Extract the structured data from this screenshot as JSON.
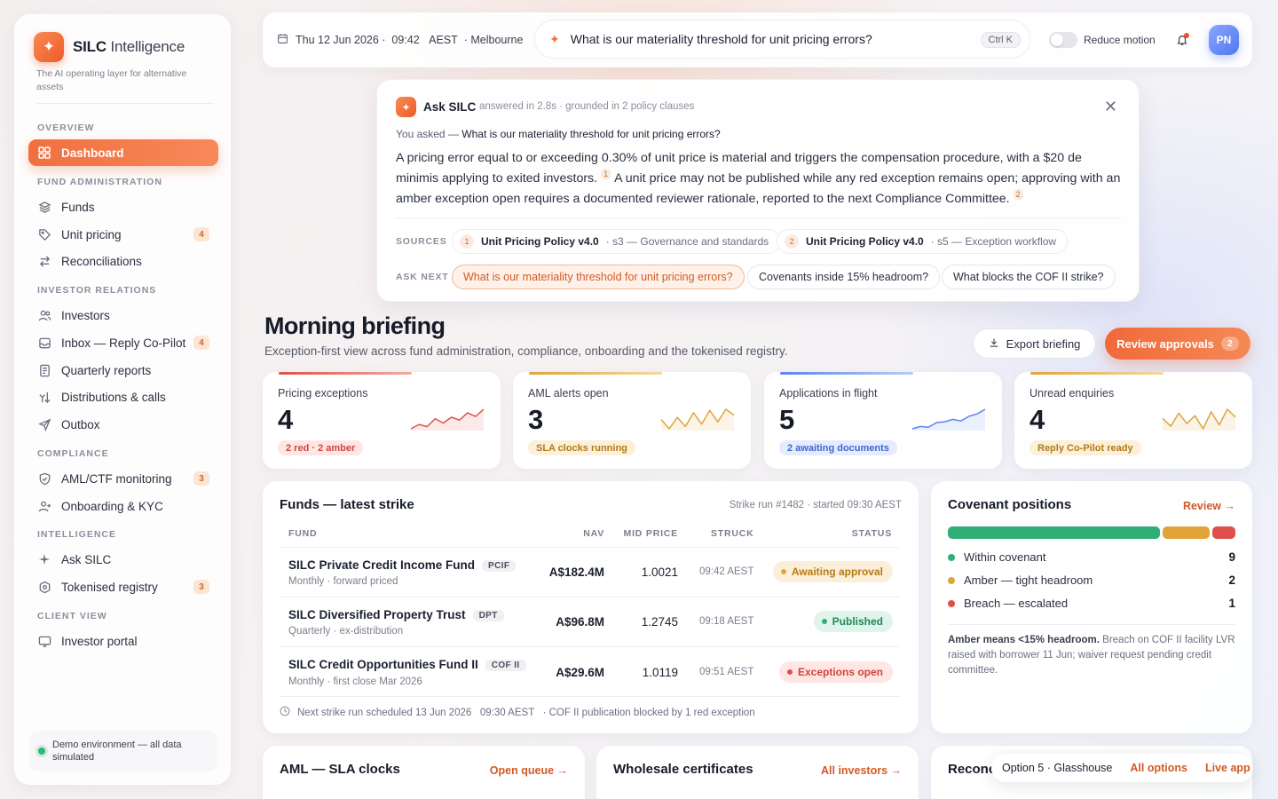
{
  "brand": {
    "name_bold": "SILC",
    "name_rest": "Intelligence",
    "tagline": "The AI operating layer for alternative assets"
  },
  "sidebar": {
    "sections": [
      "OVERVIEW",
      "FUND ADMINISTRATION",
      "INVESTOR RELATIONS",
      "COMPLIANCE",
      "INTELLIGENCE",
      "CLIENT VIEW"
    ],
    "items": [
      {
        "label": "Dashboard",
        "icon": "grid-icon"
      },
      {
        "label": "Funds",
        "icon": "layers-icon"
      },
      {
        "label": "Unit pricing",
        "icon": "tag-icon",
        "badge": "4"
      },
      {
        "label": "Reconciliations",
        "icon": "arrows-swap-icon"
      },
      {
        "label": "Investors",
        "icon": "users-icon"
      },
      {
        "label": "Inbox — Reply Co-Pilot",
        "icon": "inbox-icon",
        "badge": "4"
      },
      {
        "label": "Quarterly reports",
        "icon": "document-icon"
      },
      {
        "label": "Distributions & calls",
        "icon": "split-arrows-icon"
      },
      {
        "label": "Outbox",
        "icon": "send-icon"
      },
      {
        "label": "AML/CTF monitoring",
        "icon": "shield-check-icon",
        "badge": "3"
      },
      {
        "label": "Onboarding & KYC",
        "icon": "user-plus-icon"
      },
      {
        "label": "Ask SILC",
        "icon": "sparkle-icon"
      },
      {
        "label": "Tokenised registry",
        "icon": "hexagon-icon",
        "badge": "3"
      },
      {
        "label": "Investor portal",
        "icon": "monitor-icon"
      }
    ],
    "demo": "Demo environment — all data simulated"
  },
  "topbar": {
    "date": "Thu 12 Jun 2026 ·",
    "time": "09:42",
    "tz": "AEST",
    "city": "· Melbourne",
    "search_query": "What is our materiality threshold for unit pricing errors?",
    "shortcut": "Ctrl K",
    "reduce_motion": "Reduce motion",
    "avatar": "PN"
  },
  "ask": {
    "title": "Ask SILC",
    "meta": "answered in 2.8s · grounded in 2 policy clauses",
    "you_asked_prefix": "You asked — ",
    "you_asked": "What is our materiality threshold for unit pricing errors?",
    "answer_1": "A pricing error equal to or exceeding 0.30% of unit price is material and triggers the compensation procedure, with a $20 de minimis applying to exited investors.",
    "cite_1": "1",
    "answer_2": "A unit price may not be published while any red exception remains open; approving with an amber exception open requires a documented reviewer rationale, reported to the next Compliance Committee.",
    "cite_2": "2",
    "sources_label": "SOURCES",
    "sources": [
      {
        "n": "1",
        "title": "Unit Pricing Policy v4.0",
        "section": "· s3 — Governance and standards"
      },
      {
        "n": "2",
        "title": "Unit Pricing Policy v4.0",
        "section": "· s5 — Exception workflow"
      }
    ],
    "ask_next_label": "ASK NEXT",
    "ask_next": [
      "What is our materiality threshold for unit pricing errors?",
      "Covenants inside 15% headroom?",
      "What blocks the COF II strike?"
    ]
  },
  "briefing": {
    "title": "Morning briefing",
    "subtitle": "Exception-first view across fund administration, compliance, onboarding and the tokenised registry.",
    "export_label": "Export briefing",
    "review_label": "Review approvals",
    "review_count": "2"
  },
  "kpis": [
    {
      "label": "Pricing exceptions",
      "value": "4",
      "pill": "2 red · 2 amber",
      "color": "#e0504a",
      "spark": [
        3,
        2.4,
        2.7,
        1.6,
        2.2,
        1.4,
        1.8,
        0.8,
        1.3,
        0.3
      ]
    },
    {
      "label": "AML alerts open",
      "value": "3",
      "pill": "SLA clocks running",
      "color": "#e0a43a",
      "spark": [
        1.8,
        2.6,
        1.6,
        2.4,
        1.2,
        2.2,
        1.0,
        2.0,
        0.9,
        1.4
      ]
    },
    {
      "label": "Applications in flight",
      "value": "5",
      "pill": "2 awaiting documents",
      "color": "#5b86ee",
      "spark": [
        2.8,
        2.5,
        2.6,
        2.0,
        1.9,
        1.6,
        1.8,
        1.2,
        0.9,
        0.3
      ]
    },
    {
      "label": "Unread enquiries",
      "value": "4",
      "pill": "Reply Co-Pilot ready",
      "color": "#e0a43a",
      "spark": [
        1.4,
        2.0,
        1.0,
        1.8,
        1.2,
        2.2,
        0.9,
        1.9,
        0.7,
        1.3
      ]
    }
  ],
  "funds": {
    "title": "Funds — latest strike",
    "meta": "Strike run #1482 · started 09:30 AEST",
    "headers": [
      "FUND",
      "NAV",
      "MID PRICE",
      "STRUCK",
      "STATUS"
    ],
    "rows": [
      {
        "name": "SILC Private Credit Income Fund",
        "tag": "PCIF",
        "sub": "Monthly · forward priced",
        "nav": "A$182.4M",
        "mid": "1.0021",
        "struck": "09:42 AEST",
        "status": "Awaiting approval",
        "tone": "amber"
      },
      {
        "name": "SILC Diversified Property Trust",
        "tag": "DPT",
        "sub": "Quarterly · ex-distribution",
        "nav": "A$96.8M",
        "mid": "1.2745",
        "struck": "09:18 AEST",
        "status": "Published",
        "tone": "green"
      },
      {
        "name": "SILC Credit Opportunities Fund II",
        "tag": "COF II",
        "sub": "Monthly · first close Mar 2026",
        "nav": "A$29.6M",
        "mid": "1.0119",
        "struck": "09:51 AEST",
        "status": "Exceptions open",
        "tone": "red"
      }
    ],
    "footer": "Next strike run scheduled 13 Jun 2026   09:30 AEST   · COF II publication blocked by 1 red exception"
  },
  "covenants": {
    "title": "Covenant positions",
    "link": "Review →",
    "rows": [
      {
        "label": "Within covenant",
        "count": "9",
        "color": "#2fae78"
      },
      {
        "label": "Amber — tight headroom",
        "count": "2",
        "color": "#e0a43a"
      },
      {
        "label": "Breach — escalated",
        "count": "1",
        "color": "#e0504a"
      }
    ],
    "note_bold": "Amber means <15% headroom.",
    "note_rest": " Breach on COF II facility LVR raised with borrower 11 Jun; waiver request pending credit committee."
  },
  "bottom_cards": [
    {
      "title": "AML — SLA clocks",
      "link": "Open queue →"
    },
    {
      "title": "Wholesale certificates",
      "link": "All investors →"
    },
    {
      "title": "Reconc",
      "link": ""
    }
  ],
  "option_bar": {
    "label": "Option 5 · Glasshouse",
    "all_options": "All options",
    "live_app": "Live app"
  },
  "colors": {
    "accent": "#f0703f",
    "amber": "#e0a43a",
    "red": "#e0504a",
    "green": "#2fae78",
    "blue": "#5b86ee"
  }
}
